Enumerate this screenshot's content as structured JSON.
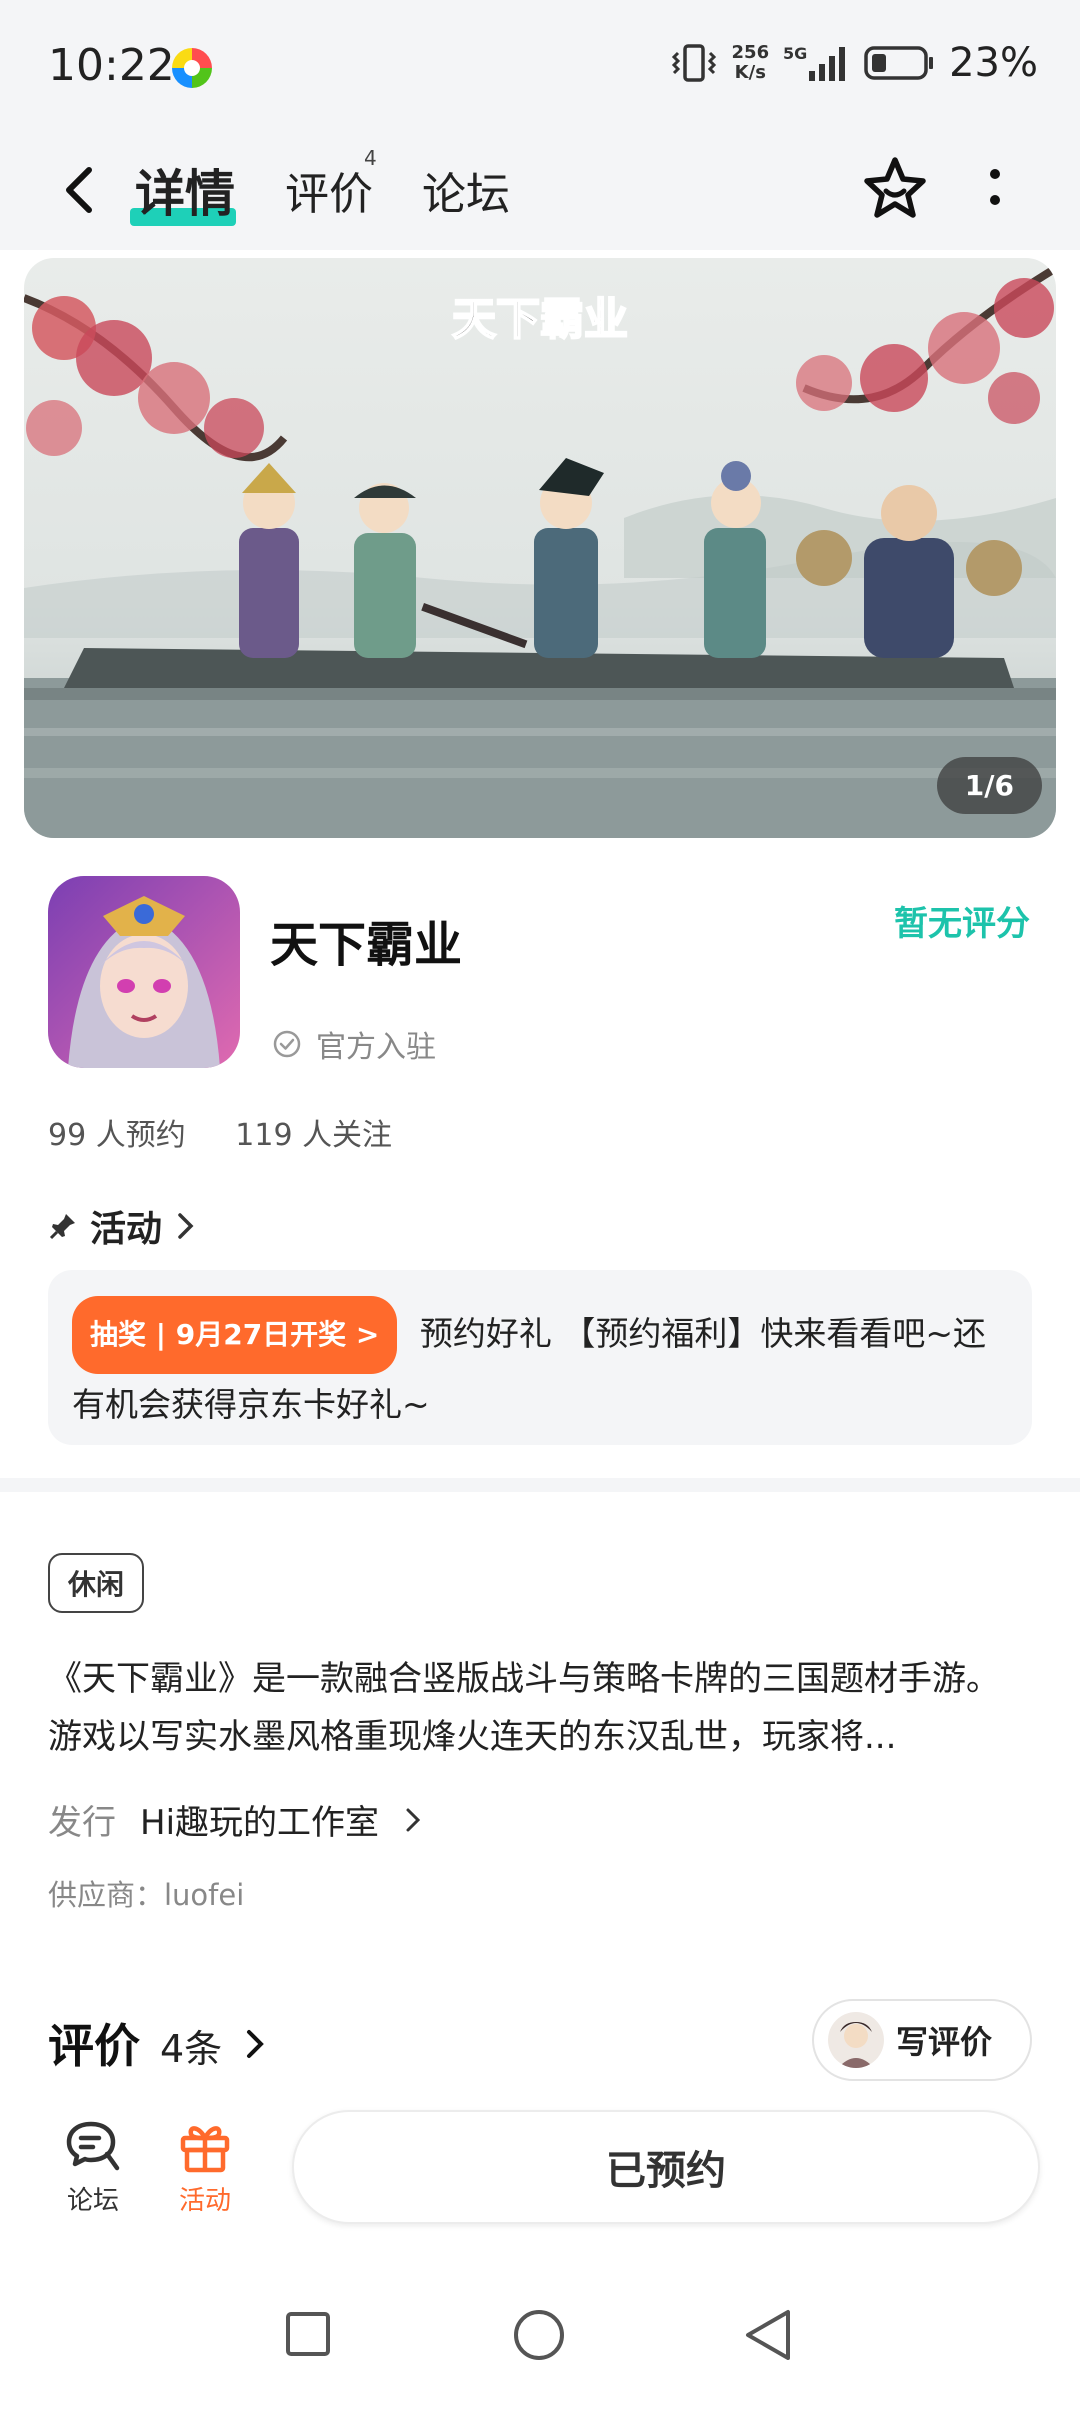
{
  "status_bar": {
    "time": "10:22",
    "net_speed_value": "256",
    "net_speed_unit": "K/s",
    "network": "5G",
    "battery": "23%"
  },
  "nav": {
    "tabs": [
      {
        "label": "详情",
        "active": true
      },
      {
        "label": "评价",
        "badge": "4"
      },
      {
        "label": "论坛"
      }
    ]
  },
  "banner": {
    "title_art": "天下霸业",
    "counter": "1/6"
  },
  "game": {
    "title": "天下霸业",
    "rating": "暂无评分",
    "official": "官方入驻",
    "reservations": "99 人预约",
    "followers": "119 人关注"
  },
  "activity": {
    "header": "活动",
    "tag": "抽奖 | 9月27日开奖 >",
    "text": "预约好礼 【预约福利】快来看看吧~还有机会获得京东卡好礼~"
  },
  "details": {
    "genre": "休闲",
    "description": "《天下霸业》是一款融合竖版战斗与策略卡牌的三国题材手游。游戏以写实水墨风格重现烽火连天的东汉乱世，玩家将...",
    "publisher_label": "发行",
    "publisher_name": "Hi趣玩的工作室",
    "supplier": "供应商：luofei"
  },
  "reviews": {
    "title": "评价",
    "count": "4条",
    "write_button": "写评价"
  },
  "bottom_bar": {
    "forum_label": "论坛",
    "activity_label": "活动",
    "reserve_button": "已预约"
  },
  "colors": {
    "accent_teal": "#1dc3ab",
    "accent_orange": "#ff6a2c",
    "bg_gray": "#f4f5f7"
  }
}
